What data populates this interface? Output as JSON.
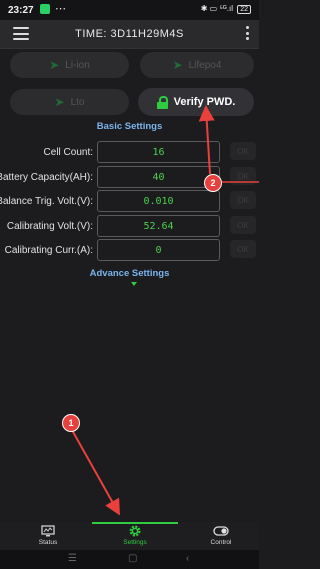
{
  "status_bar": {
    "time": "23:27",
    "overflow": "⋯",
    "indicators": "✱ ▭ ⁵ᴳ.ıl",
    "battery": "22"
  },
  "app_bar": {
    "title": "TIME: 3D11H29M4S"
  },
  "chemistry_buttons": [
    {
      "label": "Li-ion"
    },
    {
      "label": "Lifepo4"
    },
    {
      "label": "Lto"
    }
  ],
  "verify_button": {
    "label": "Verify PWD."
  },
  "basic_settings": {
    "title": "Basic Settings",
    "rows": [
      {
        "label": "Cell Count:",
        "value": "16",
        "ok": "OK"
      },
      {
        "label": "Battery Capacity(AH):",
        "value": "40",
        "ok": "OK"
      },
      {
        "label": "Balance Trig. Volt.(V):",
        "value": "0.010",
        "ok": "OK"
      },
      {
        "label": "Calibrating Volt.(V):",
        "value": "52.64",
        "ok": "OK"
      },
      {
        "label": "Calibrating Curr.(A):",
        "value": "0",
        "ok": "OK"
      }
    ]
  },
  "advance_settings": {
    "label": "Advance Settings"
  },
  "annotations": [
    {
      "number": "1",
      "color": "#e8403c"
    },
    {
      "number": "2",
      "color": "#e8403c"
    }
  ],
  "bottom_nav": {
    "items": [
      {
        "label": "Status",
        "icon": "status-icon"
      },
      {
        "label": "Settings",
        "icon": "gear-icon"
      },
      {
        "label": "Control",
        "icon": "toggle-icon"
      }
    ],
    "active": "Settings",
    "active_color": "#2ecc40"
  },
  "system_nav": {
    "menu": "☰",
    "home": "▢",
    "back": "‹"
  }
}
